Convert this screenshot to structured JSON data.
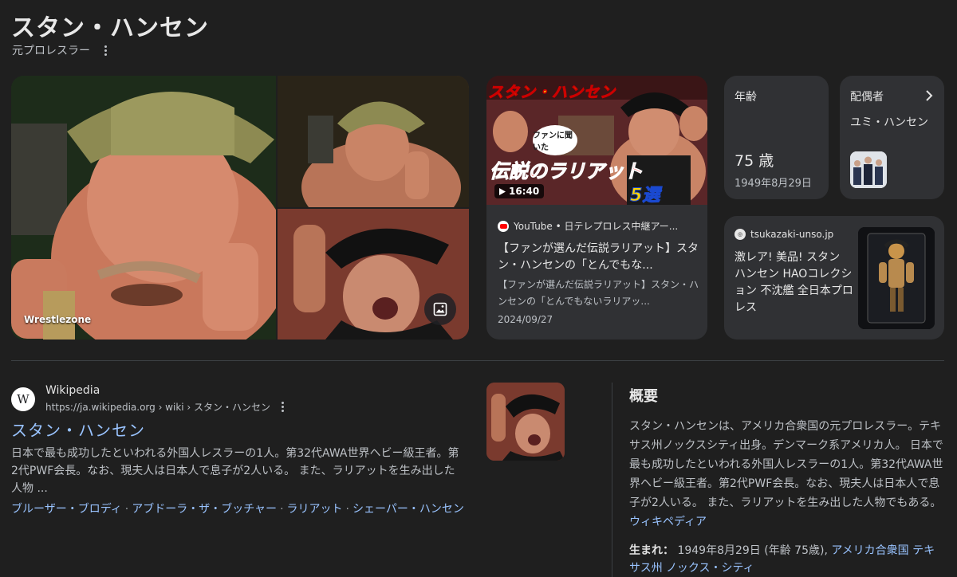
{
  "header": {
    "title": "スタン・ハンセン",
    "subtitle": "元プロレスラー"
  },
  "images": {
    "main_credit": "Wrestlezone"
  },
  "video": {
    "thumb_banner": "スタン・ハンセン",
    "thumb_bubble": "ファンに聞いた",
    "thumb_headline": "伝説のラリアット",
    "thumb_count": "5選",
    "duration": "16:40",
    "source": "YouTube • 日テレプロレス中継アー...",
    "title": "【ファンが選んだ伝説ラリアット】スタン・ハンセンの「とんでもな...",
    "description": "【ファンが選んだ伝説ラリアット】スタン・ハンセンの「とんでもないラリアッ...",
    "date": "2024/09/27"
  },
  "age_card": {
    "label": "年齢",
    "value": "75 歳",
    "birthdate": "1949年8月29日"
  },
  "spouse_card": {
    "label": "配偶者",
    "name": "ユミ・ハンセン"
  },
  "shop_card": {
    "source": "tsukazaki-unso.jp",
    "title": "激レア! 美品! スタン ハンセン HAOコレクション 不沈艦 全日本プロレス"
  },
  "wiki": {
    "site": "Wikipedia",
    "url": "https://ja.wikipedia.org › wiki › スタン・ハンセン",
    "title": "スタン・ハンセン",
    "snippet": "日本で最も成功したといわれる外国人レスラーの1人。第32代AWA世界ヘビー級王者。第2代PWF会長。なお、現夫人は日本人で息子が2人いる。 また、ラリアットを生み出した人物 ...",
    "links": [
      "ブルーザー・ブロディ",
      "アブドーラ・ザ・ブッチャー",
      "ラリアット",
      "シェーパー・ハンセン"
    ]
  },
  "overview": {
    "title": "概要",
    "text": "スタン・ハンセンは、アメリカ合衆国の元プロレスラー。テキサス州ノックスシティ出身。デンマーク系アメリカ人。 日本で最も成功したといわれる外国人レスラーの1人。第32代AWA世界ヘビー級王者。第2代PWF会長。なお、現夫人は日本人で息子が2人いる。 また、ラリアットを生み出した人物でもある。",
    "source_link": "ウィキペディア",
    "born_label": "生まれ：",
    "born_value": "1949年8月29日 (年齢 75歳),",
    "born_place": "アメリカ合衆国 テキサス州 ノックス・シティ"
  },
  "colors": {
    "background": "#1f1f1f",
    "card": "#303134",
    "link": "#99c3ff",
    "text_secondary": "#bdc1c6"
  }
}
